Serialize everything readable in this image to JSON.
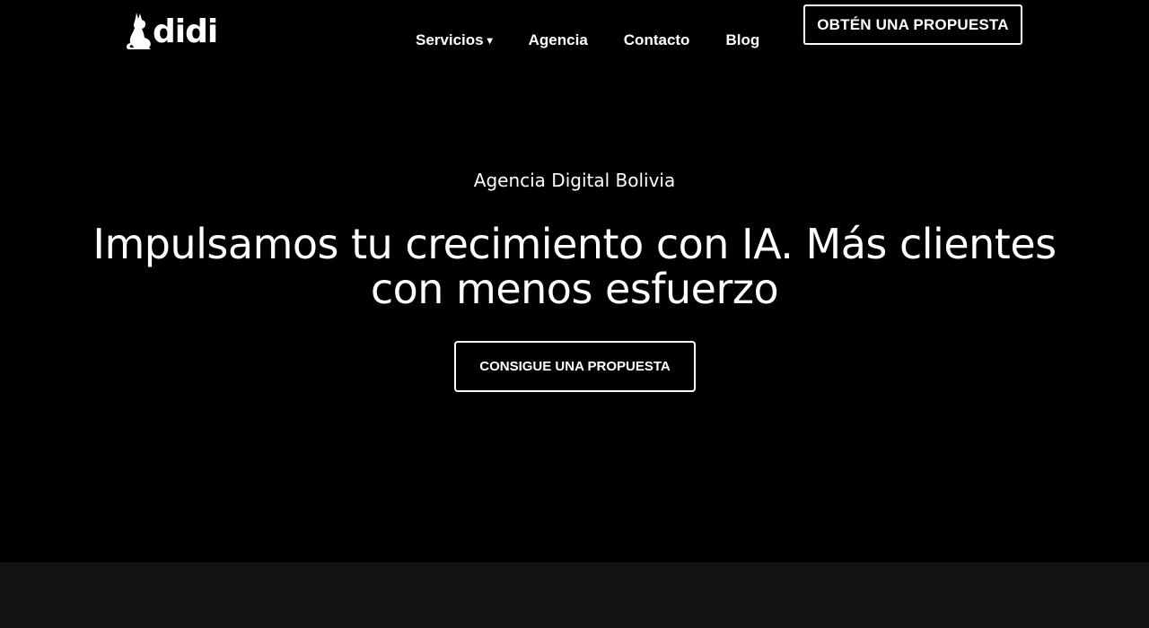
{
  "header": {
    "logo_text": "didi",
    "nav": [
      {
        "label": "Servicios",
        "has_dropdown": true,
        "caret_icon": "caret-down-icon"
      },
      {
        "label": "Agencia"
      },
      {
        "label": "Contacto"
      },
      {
        "label": "Blog"
      }
    ],
    "cta_label": "OBTÉN UNA PROPUESTA"
  },
  "hero": {
    "kicker": "Agencia Digital Bolivia",
    "title": "Impulsamos tu crecimiento con IA. Más clientes con menos esfuerzo",
    "cta_label": "CONSIGUE UNA PROPUESTA"
  },
  "colors": {
    "background": "#000000",
    "text": "#ffffff",
    "next_section_bg": "#141414"
  },
  "icons": {
    "logo_mark": "dog-logo-icon",
    "caret": "caret-down-icon"
  }
}
